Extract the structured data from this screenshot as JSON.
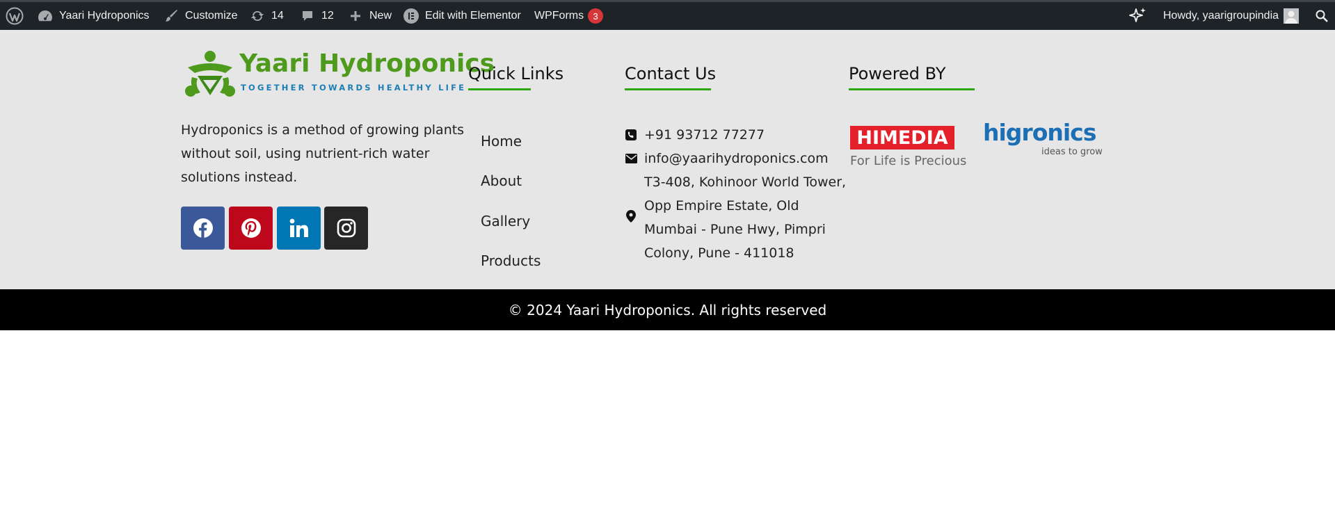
{
  "adminbar": {
    "site_name": "Yaari Hydroponics",
    "customize": "Customize",
    "updates_count": "14",
    "comments_count": "12",
    "new": "New",
    "elementor": "Edit with Elementor",
    "wpforms": "WPForms",
    "wpforms_badge": "3",
    "howdy": "Howdy, yaarigroupindia"
  },
  "brand": {
    "name": "Yaari Hydroponics",
    "tagline": "TOGETHER TOWARDS HEALTHY LIFE",
    "description": "Hydroponics is a method of growing plants without soil, using nutrient-rich water solutions instead."
  },
  "social": [
    {
      "name": "facebook",
      "color": "#3b5998"
    },
    {
      "name": "pinterest",
      "color": "#bd081c"
    },
    {
      "name": "linkedin",
      "color": "#0077b5"
    },
    {
      "name": "instagram",
      "color": "#262626"
    }
  ],
  "quick_links": {
    "title": "Quick Links",
    "items": [
      "Home",
      "About",
      "Gallery",
      "Products"
    ]
  },
  "contact": {
    "title": "Contact Us",
    "phone": "+91 93712 77277",
    "email": "info@yaarihydroponics.com",
    "address": "T3-408, Kohinoor World Tower, Opp Empire Estate, Old Mumbai - Pune Hwy, Pimpri Colony, Pune - 411018"
  },
  "powered_by": {
    "title": "Powered BY",
    "himedia": "HIMEDIA",
    "himedia_tagline": "For Life is Precious",
    "higronics": "higronics",
    "higronics_tagline": "ideas to grow"
  },
  "footer": {
    "copyright": "© 2024 Yaari Hydroponics. All rights reserved"
  },
  "colors": {
    "accent_green": "#2aa70f",
    "adminbar_bg": "#1d2327",
    "footer_bg": "#e6e6e6"
  }
}
